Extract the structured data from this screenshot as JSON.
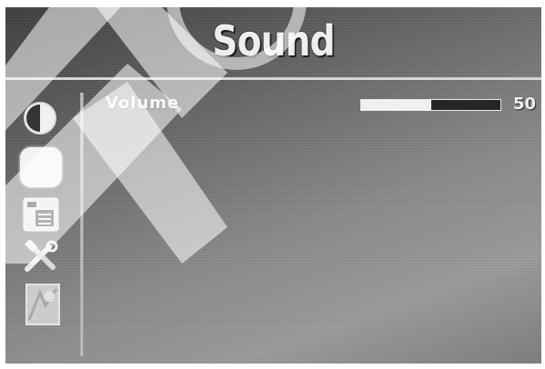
{
  "menu": {
    "title": "Sound"
  },
  "sidebar": {
    "items": [
      {
        "icon": "contrast-icon",
        "selected": false
      },
      {
        "icon": "sound-icon",
        "selected": true
      },
      {
        "icon": "setup-icon",
        "selected": false
      },
      {
        "icon": "tools-icon",
        "selected": false
      },
      {
        "icon": "other-icon",
        "selected": false
      }
    ]
  },
  "settings": {
    "volume": {
      "label": "Volume",
      "value": "50",
      "level_percent": 50
    }
  },
  "colors": {
    "text": "#f4f4f4",
    "bar_fill": "#f4f4f4",
    "bar_track": "#222222"
  }
}
